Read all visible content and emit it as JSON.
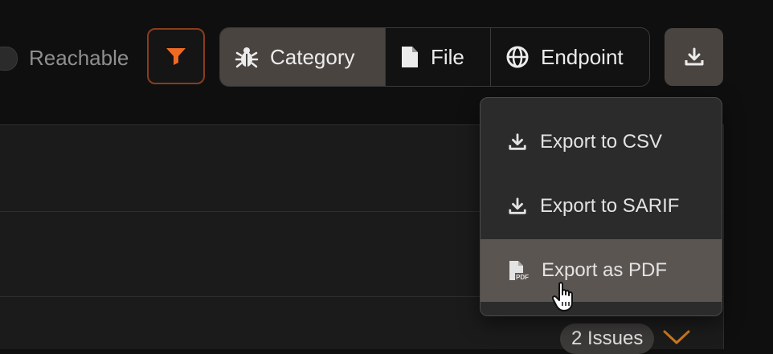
{
  "toolbar": {
    "reachable_label": "Reachable",
    "filter_icon": "funnel-icon",
    "filter_accent": "#f06a24",
    "groups": [
      {
        "label": "Category",
        "icon": "bug-icon",
        "active": true
      },
      {
        "label": "File",
        "icon": "file-icon",
        "active": false
      },
      {
        "label": "Endpoint",
        "icon": "globe-icon",
        "active": false
      }
    ],
    "download_icon": "download-icon"
  },
  "export_menu": {
    "items": [
      {
        "label": "Export to CSV",
        "icon": "download-icon"
      },
      {
        "label": "Export to SARIF",
        "icon": "download-icon"
      },
      {
        "label": "Export as PDF",
        "icon": "pdf-file-icon",
        "hovered": true
      }
    ]
  },
  "table": {
    "issues_badge": "2 Issues",
    "expand_icon": "chevron-down-icon",
    "chevron_color": "#c9791f"
  }
}
